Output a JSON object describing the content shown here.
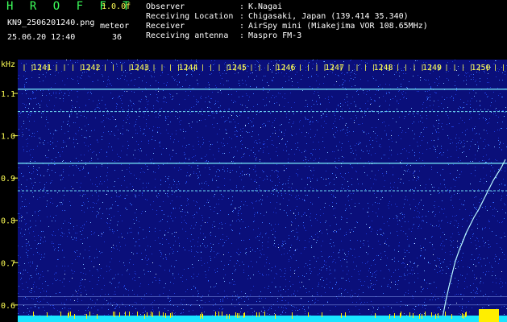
{
  "header": {
    "app_title": "H R O F F T",
    "version": "1.0.0f",
    "filename": "KN9_2506201240.png",
    "meteor_label": "meteor",
    "datetime": "25.06.20 12:40",
    "meteor_count": "36"
  },
  "metadata": [
    {
      "label": "Observer",
      "value": "K.Nagai"
    },
    {
      "label": "Receiving Location",
      "value": "Chigasaki, Japan (139.414 35.340)"
    },
    {
      "label": "Receiver",
      "value": "AirSpy mini (Miakejima VOR 108.65MHz)"
    },
    {
      "label": "Receiving antenna",
      "value": "Maspro FM-3"
    }
  ],
  "chart_data": {
    "type": "heatmap",
    "x_tick_labels": [
      "1241",
      "1242",
      "1243",
      "1244",
      "1245",
      "1246",
      "1247",
      "1248",
      "1249",
      "1250"
    ],
    "y_unit": "kHz",
    "y_tick_labels": [
      "1.1",
      "1.0",
      "0.9",
      "0.8",
      "0.7",
      "0.6"
    ],
    "y_ticks": [
      1.1,
      1.0,
      0.9,
      0.8,
      0.7,
      0.6
    ],
    "ylim": [
      0.575,
      1.18
    ],
    "horizontal_carriers_khz": [
      1.11,
      1.057,
      0.935,
      0.87,
      0.62,
      0.6
    ],
    "background_color": "#0a0f7a",
    "noise_colors": [
      "#1e3cd8",
      "#3a78ff",
      "#7ab8ff",
      "#cfe8ff"
    ],
    "carrier_color": "#7cf3ff",
    "meteor_color": "#b8f8ff",
    "baseline_color": "#19e5ff",
    "baseline_burst_color": "#ffee00"
  }
}
